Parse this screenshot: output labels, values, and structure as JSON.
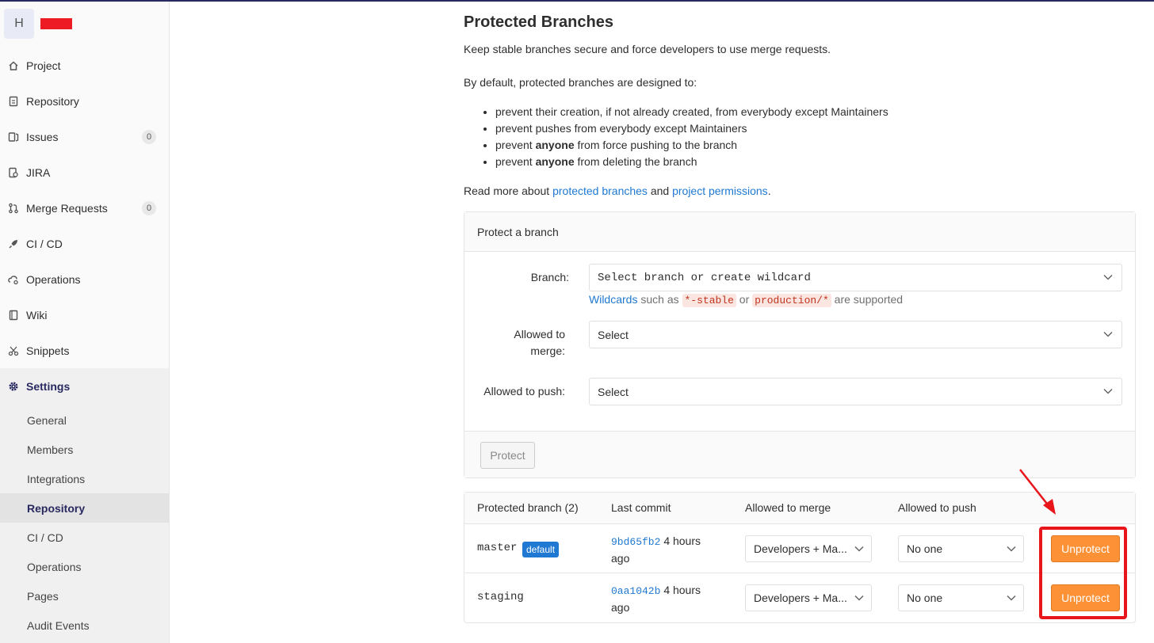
{
  "sidebar": {
    "avatar_letter": "H",
    "items": [
      {
        "label": "Project",
        "icon": "home-icon"
      },
      {
        "label": "Repository",
        "icon": "doc-icon"
      },
      {
        "label": "Issues",
        "icon": "issues-icon",
        "count": "0"
      },
      {
        "label": "JIRA",
        "icon": "jira-icon"
      },
      {
        "label": "Merge Requests",
        "icon": "merge-request-icon",
        "count": "0"
      },
      {
        "label": "CI / CD",
        "icon": "rocket-icon"
      },
      {
        "label": "Operations",
        "icon": "cloud-gear-icon"
      },
      {
        "label": "Wiki",
        "icon": "book-icon"
      },
      {
        "label": "Snippets",
        "icon": "scissors-icon"
      },
      {
        "label": "Settings",
        "icon": "gear-icon"
      }
    ],
    "settings_sub": [
      "General",
      "Members",
      "Integrations",
      "Repository",
      "CI / CD",
      "Operations",
      "Pages",
      "Audit Events"
    ]
  },
  "main": {
    "title": "Protected Branches",
    "lead": "Keep stable branches secure and force developers to use merge requests.",
    "intro": "By default, protected branches are designed to:",
    "bullets": {
      "b1": "prevent their creation, if not already created, from everybody except Maintainers",
      "b2": "prevent pushes from everybody except Maintainers",
      "b3_pre": "prevent ",
      "b3_bold": "anyone",
      "b3_post": " from force pushing to the branch",
      "b4_pre": "prevent ",
      "b4_bold": "anyone",
      "b4_post": " from deleting the branch"
    },
    "readmore": {
      "pre": "Read more about ",
      "link1": "protected branches",
      "mid": " and ",
      "link2": "project permissions",
      "post": "."
    }
  },
  "protect_form": {
    "header": "Protect a branch",
    "branch_label": "Branch:",
    "branch_placeholder": "Select branch or create wildcard",
    "hint_link": "Wildcards",
    "hint_mid1": " such as ",
    "hint_code1": "*-stable",
    "hint_mid2": " or ",
    "hint_code2": "production/*",
    "hint_post": " are supported",
    "merge_label_1": "Allowed to",
    "merge_label_2": "merge:",
    "merge_value": "Select",
    "push_label": "Allowed to push:",
    "push_value": "Select",
    "protect_button": "Protect"
  },
  "table": {
    "headers": [
      "Protected branch (2)",
      "Last commit",
      "Allowed to merge",
      "Allowed to push"
    ],
    "rows": [
      {
        "branch": "master",
        "badge": "default",
        "sha": "9bd65fb2",
        "when_1": "4 hours",
        "when_2": "ago",
        "merge": "Developers + Ma...",
        "push": "No one",
        "action": "Unprotect"
      },
      {
        "branch": "staging",
        "sha": "0aa1042b",
        "when_1": "4 hours",
        "when_2": "ago",
        "merge": "Developers + Ma...",
        "push": "No one",
        "action": "Unprotect"
      }
    ]
  },
  "colors": {
    "accent": "#292961",
    "link": "#1f78d1",
    "unprotect": "#fc9136",
    "annotation": "#e8151b",
    "redaction": "#ed1c24"
  }
}
